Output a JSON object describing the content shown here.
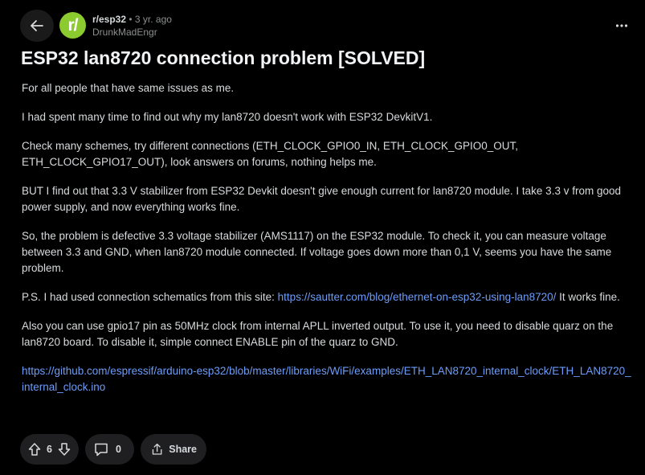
{
  "header": {
    "subreddit": "r/esp32",
    "separator": "•",
    "age": "3 yr. ago",
    "author": "DrunkMadEngr",
    "avatar_glyph": "r/"
  },
  "post": {
    "title": "ESP32 lan8720 connection problem [SOLVED]",
    "paragraphs": {
      "p1": "For all people that have same issues as me.",
      "p2": "I had spent many time to find out why my lan8720 doesn't work with ESP32 DevkitV1.",
      "p3": "Check many schemes, try different connections (ETH_CLOCK_GPIO0_IN, ETH_CLOCK_GPIO0_OUT, ETH_CLOCK_GPIO17_OUT), look answers on forums, nothing helps me.",
      "p4": "BUT I find out that 3.3 V stabilizer from ESP32 Devkit doesn't give enough current for lan8720 module. I take 3.3 v from good power supply, and now everything works fine.",
      "p5": "So, the problem is defective 3.3 voltage stabilizer (AMS1117) on the ESP32 module. To check it, you can measure voltage between 3.3 and GND, when lan8720 module connected. If voltage goes down more than 0,1 V, seems you have the same problem.",
      "p6_prefix": "P.S. I had used connection schematics from this site: ",
      "p6_link": "https://sautter.com/blog/ethernet-on-esp32-using-lan8720/",
      "p6_suffix": " It works fine.",
      "p7": "Also you can use gpio17 pin as 50MHz clock from internal APLL inverted output. To use it, you need to disable quarz on the lan8720 board. To disable it, simple connect ENABLE pin of the quarz to GND.",
      "p8_link": "https://github.com/espressif/arduino-esp32/blob/master/libraries/WiFi/examples/ETH_LAN8720_internal_clock/ETH_LAN8720_internal_clock.ino"
    }
  },
  "actions": {
    "vote_count": "6",
    "comment_count": "0",
    "share_label": "Share"
  },
  "icons": {
    "back": "arrow-left-icon",
    "more": "more-horizontal-icon",
    "upvote": "upvote-arrow-icon",
    "downvote": "downvote-arrow-icon",
    "comment": "comment-bubble-icon",
    "share": "share-icon"
  },
  "colors": {
    "background": "#000000",
    "text": "#d7dadc",
    "title": "#f2f3f5",
    "muted": "#8b8e90",
    "link": "#6c9dfa",
    "avatar": "#8ccb30",
    "pill": "#1f1f21"
  }
}
